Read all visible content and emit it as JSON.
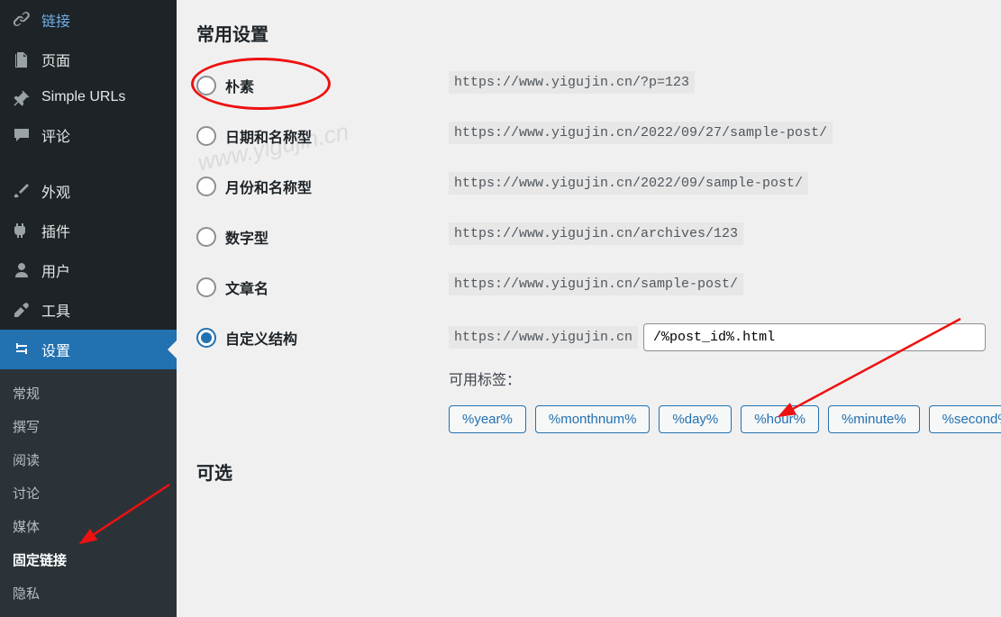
{
  "sidebar": {
    "items": [
      {
        "label": "链接",
        "icon": "link"
      },
      {
        "label": "页面",
        "icon": "page"
      },
      {
        "label": "Simple URLs",
        "icon": "pin"
      },
      {
        "label": "评论",
        "icon": "comment"
      },
      {
        "label": "外观",
        "icon": "brush"
      },
      {
        "label": "插件",
        "icon": "plugin"
      },
      {
        "label": "用户",
        "icon": "user"
      },
      {
        "label": "工具",
        "icon": "wrench"
      },
      {
        "label": "设置",
        "icon": "settings",
        "active": true
      }
    ],
    "submenu": [
      {
        "label": "常规"
      },
      {
        "label": "撰写"
      },
      {
        "label": "阅读"
      },
      {
        "label": "讨论"
      },
      {
        "label": "媒体"
      },
      {
        "label": "固定链接",
        "current": true
      },
      {
        "label": "隐私"
      }
    ]
  },
  "content": {
    "section_title": "常用设置",
    "section_title_optional": "可选",
    "options": [
      {
        "label": "朴素",
        "example": "https://www.yigujin.cn/?p=123"
      },
      {
        "label": "日期和名称型",
        "example": "https://www.yigujin.cn/2022/09/27/sample-post/"
      },
      {
        "label": "月份和名称型",
        "example": "https://www.yigujin.cn/2022/09/sample-post/"
      },
      {
        "label": "数字型",
        "example": "https://www.yigujin.cn/archives/123"
      },
      {
        "label": "文章名",
        "example": "https://www.yigujin.cn/sample-post/"
      }
    ],
    "custom": {
      "label": "自定义结构",
      "prefix": "https://www.yigujin.cn",
      "value": "/%post_id%.html"
    },
    "available_tags_label": "可用标签：",
    "tags": [
      "%year%",
      "%monthnum%",
      "%day%",
      "%hour%",
      "%minute%",
      "%second%"
    ]
  },
  "watermark": "www.yigujin.cn"
}
